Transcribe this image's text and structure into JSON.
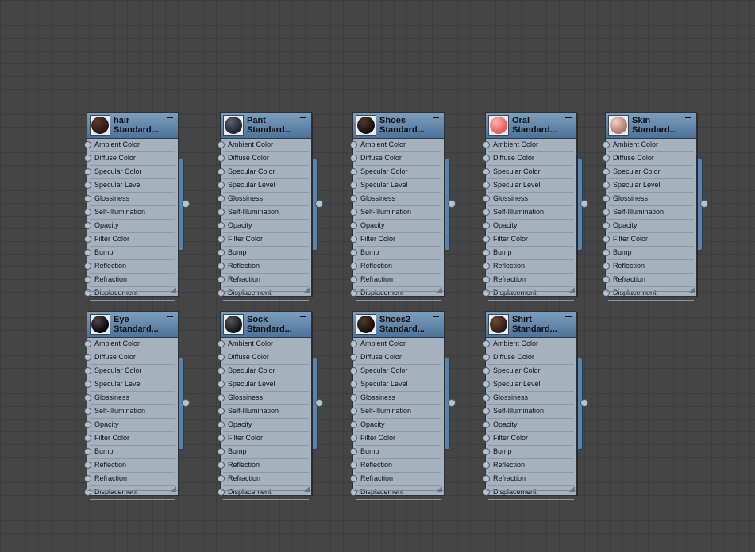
{
  "slots": [
    "Ambient Color",
    "Diffuse Color",
    "Specular Color",
    "Specular Level",
    "Glossiness",
    "Self-Illumination",
    "Opacity",
    "Filter Color",
    "Bump",
    "Reflection",
    "Refraction",
    "Displacement"
  ],
  "nodes": [
    {
      "name": "hair",
      "type": "Standard...",
      "sphere": [
        "#5a3a2e",
        "#2a1510"
      ]
    },
    {
      "name": "Pant",
      "type": "Standard...",
      "sphere": [
        "#5a6070",
        "#1d2130"
      ]
    },
    {
      "name": "Shoes",
      "type": "Standard...",
      "sphere": [
        "#4a3a30",
        "#150d08"
      ]
    },
    {
      "name": "Oral",
      "type": "Standard...",
      "sphere": [
        "#ffb0b0",
        "#e25a5a"
      ]
    },
    {
      "name": "Skin",
      "type": "Standard...",
      "sphere": [
        "#f0d0c4",
        "#a9786a"
      ]
    },
    {
      "name": "Eye",
      "type": "Standard...",
      "sphere": [
        "#4a4a4a",
        "#050505"
      ]
    },
    {
      "name": "Sock",
      "type": "Standard...",
      "sphere": [
        "#555555",
        "#111111"
      ]
    },
    {
      "name": "Shoes2",
      "type": "Standard...",
      "sphere": [
        "#4a3a30",
        "#150d08"
      ]
    },
    {
      "name": "Shirt",
      "type": "Standard...",
      "sphere": [
        "#6a4a3c",
        "#2d1810"
      ]
    }
  ]
}
